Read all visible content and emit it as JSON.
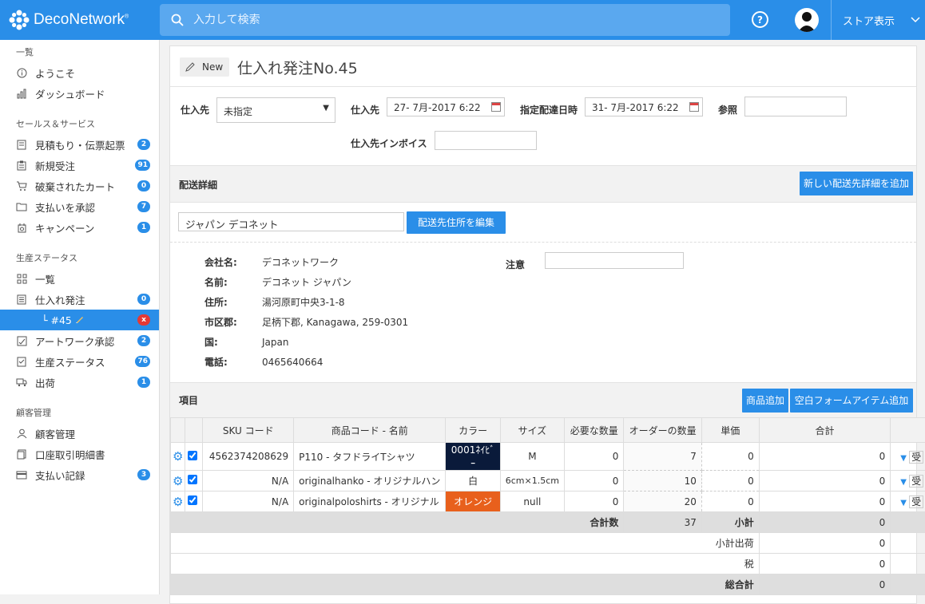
{
  "app": {
    "logo_text": "DecoNetwork",
    "logo_mark": "®",
    "search_placeholder": "入力して検索",
    "help_symbol": "?",
    "store_view_label": "ストア表示"
  },
  "sidebar": {
    "sections": [
      {
        "title": "一覧",
        "items": [
          {
            "label": "ようこそ",
            "icon": "info-icon"
          },
          {
            "label": "ダッシュボード",
            "icon": "bar-chart-icon"
          }
        ]
      },
      {
        "title": "セールス＆サービス",
        "items": [
          {
            "label": "見積もり・伝票起票",
            "icon": "document-icon",
            "badge": "2"
          },
          {
            "label": "新規受注",
            "icon": "clipboard-icon",
            "badge": "91"
          },
          {
            "label": "破棄されたカート",
            "icon": "cart-icon",
            "badge": "0"
          },
          {
            "label": "支払いを承認",
            "icon": "folder-icon",
            "badge": "7"
          },
          {
            "label": "キャンペーン",
            "icon": "campaign-icon",
            "badge": "1"
          }
        ]
      },
      {
        "title": "生産ステータス",
        "items": [
          {
            "label": "一覧",
            "icon": "grid-icon"
          },
          {
            "label": "仕入れ発注",
            "icon": "list-icon",
            "badge": "0"
          },
          {
            "label": "└ #45",
            "icon": "",
            "badge": "x",
            "active": true
          },
          {
            "label": "アートワーク承認",
            "icon": "image-check-icon",
            "badge": "2"
          },
          {
            "label": "生産ステータス",
            "icon": "production-icon",
            "badge": "76"
          },
          {
            "label": "出荷",
            "icon": "truck-icon",
            "badge": "1"
          }
        ]
      },
      {
        "title": "顧客管理",
        "items": [
          {
            "label": "顧客管理",
            "icon": "user-icon"
          },
          {
            "label": "口座取引明細書",
            "icon": "statement-icon"
          },
          {
            "label": "支払い記録",
            "icon": "card-icon",
            "badge": "3"
          }
        ]
      }
    ]
  },
  "header": {
    "new_label": "New",
    "title": "仕入れ発注No.45"
  },
  "form": {
    "supplier_label": "仕入先",
    "supplier_value": "未指定",
    "supplier_date_label": "仕入先",
    "supplier_date_value": "27- 7月-2017 6:22",
    "delivery_label": "指定配達日時",
    "delivery_value": "31- 7月-2017 6:22",
    "reference_label": "参照",
    "reference_value": "",
    "invoice_label": "仕入先インボイス",
    "invoice_value": ""
  },
  "shipping": {
    "section_label": "配送詳細",
    "add_button": "新しい配送先詳細を追加",
    "address_select": "ジャパン デコネット",
    "edit_button": "配送先住所を編集",
    "note_label": "注意",
    "rows": [
      {
        "label": "会社名:",
        "value": "デコネットワーク"
      },
      {
        "label": "名前:",
        "value": "デコネット ジャパン"
      },
      {
        "label": "住所:",
        "value": "湯河原町中央3-1-8"
      },
      {
        "label": "市区郡:",
        "value": "足柄下郡, Kanagawa, 259-0301"
      },
      {
        "label": "国:",
        "value": "Japan"
      },
      {
        "label": "電話:",
        "value": "0465640664"
      }
    ]
  },
  "items": {
    "section_label": "項目",
    "add_product_button": "商品追加",
    "add_blank_button": "空白フォームアイテム追加",
    "columns": [
      "SKU コード",
      "商品コード - 名前",
      "カラー",
      "サイズ",
      "必要な数量",
      "オーダーの数量",
      "単価",
      "合計"
    ],
    "rows": [
      {
        "sku": "4562374208629",
        "product": "P110 - タフドライTシャツ",
        "color": "0001ﾈｲﾋﾞｰ",
        "color_bg": "#0a1a3a",
        "color_fg": "#ffffff",
        "size": "M",
        "required": "0",
        "qty": "7",
        "unit": "0",
        "total": "0",
        "extra": "受"
      },
      {
        "sku": "N/A",
        "product": "originalhanko - オリジナルハン",
        "color": "白",
        "color_bg": "#ffffff",
        "color_fg": "#333333",
        "size": "6cm×1.5cm",
        "required": "0",
        "qty": "10",
        "unit": "0",
        "total": "0",
        "extra": "受"
      },
      {
        "sku": "N/A",
        "product": "originalpoloshirts - オリジナル",
        "color": "オレンジ",
        "color_bg": "#e8601c",
        "color_fg": "#ffffff",
        "size": "null",
        "required": "0",
        "qty": "20",
        "unit": "0",
        "total": "0",
        "extra": "受"
      }
    ],
    "total_qty_label": "合計数",
    "total_qty": "37",
    "subtotal_label": "小計",
    "subtotal": "0",
    "subtotal_shipping_label": "小計出荷",
    "subtotal_shipping": "0",
    "tax_label": "税",
    "tax": "0",
    "grand_total_label": "総合計",
    "grand_total": "0"
  },
  "colors": {
    "accent": "#2a8ee8",
    "badge_red": "#e53935"
  }
}
